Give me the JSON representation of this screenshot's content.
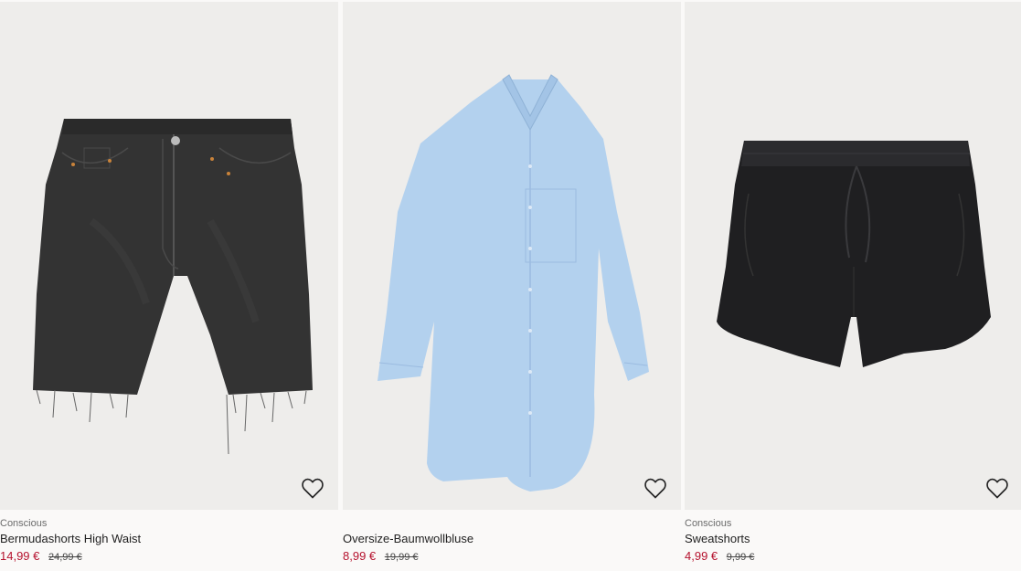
{
  "products": [
    {
      "tag": "Conscious",
      "name": "Bermudashorts High Waist",
      "price": "14,99 €",
      "old_price": "24,99 €",
      "image_icon": "black-denim-bermuda-shorts",
      "favorite_icon": "heart-outline-icon"
    },
    {
      "tag": "",
      "name": "Oversize-Baumwollbluse",
      "price": "8,99 €",
      "old_price": "19,99 €",
      "image_icon": "light-blue-oversize-blouse",
      "favorite_icon": "heart-outline-icon"
    },
    {
      "tag": "Conscious",
      "name": "Sweatshorts",
      "price": "4,99 €",
      "old_price": "9,99 €",
      "image_icon": "black-sweatshorts",
      "favorite_icon": "heart-outline-icon"
    }
  ],
  "colors": {
    "sale_price": "#b5122e",
    "image_background": "#eeedeb",
    "page_background": "#faf9f8"
  }
}
